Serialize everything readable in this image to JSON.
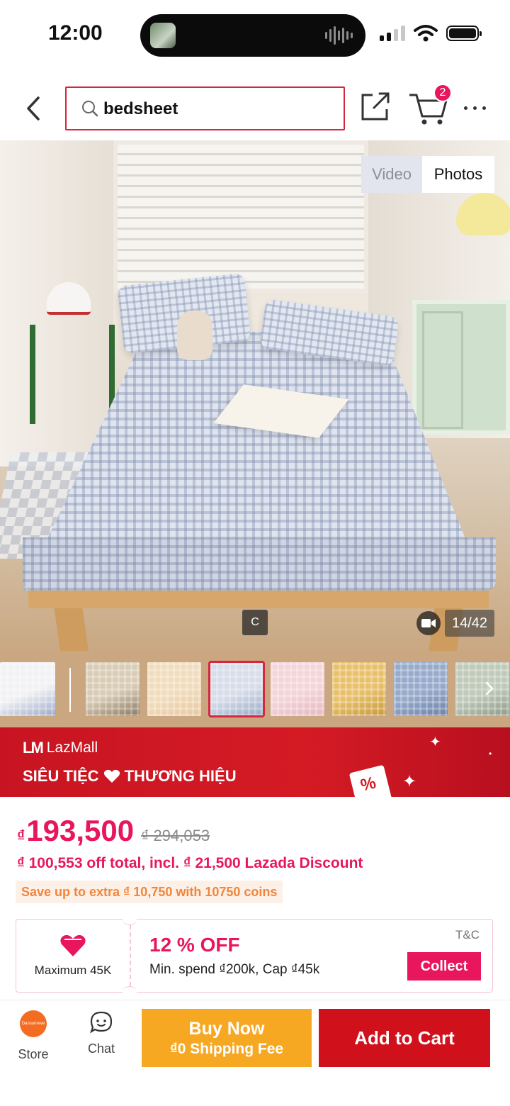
{
  "status_bar": {
    "time": "12:00"
  },
  "header": {
    "search_query": "bedsheet",
    "cart_count": "2"
  },
  "gallery": {
    "toggle_video": "Video",
    "toggle_photos": "Photos",
    "active_toggle": "Photos",
    "c_label": "C",
    "counter": "14/42",
    "thumbnails": [
      {
        "name": "thumb-fitted-sheet-info",
        "colors": [
          "#f2f2f4",
          "#9aa9c8"
        ]
      },
      {
        "name": "thumb-beige-check",
        "colors": [
          "#d9ccb5",
          "#8c7a62"
        ]
      },
      {
        "name": "thumb-cream",
        "colors": [
          "#f1dcbd",
          "#e7c9a0"
        ]
      },
      {
        "name": "thumb-blue-check",
        "colors": [
          "#d7deea",
          "#9aaac6"
        ],
        "selected": true
      },
      {
        "name": "thumb-pink",
        "colors": [
          "#f3d5da",
          "#e6b7bf"
        ]
      },
      {
        "name": "thumb-yellow-check",
        "colors": [
          "#e8c06b",
          "#c89a3a"
        ]
      },
      {
        "name": "thumb-blue-floral",
        "colors": [
          "#97aacb",
          "#6d82a8"
        ]
      },
      {
        "name": "thumb-green-check",
        "colors": [
          "#bfcab9",
          "#8e9c89"
        ]
      }
    ]
  },
  "banner": {
    "brand": "LazMall",
    "title_part1": "SIÊU TIỆC",
    "title_part2": "THƯƠNG HIỆU",
    "brand_color": "#d41b24"
  },
  "price": {
    "currency": "₫",
    "current": "193,500",
    "original": "₫ 294,053",
    "discount_text": "₫ 100,553 off total, incl. ₫ 21,500 Lazada Discount",
    "coins_text": "Save up to extra ₫ 10,750 with 10750 coins",
    "accent_color": "#e8175d"
  },
  "voucher": {
    "max_label": "Maximum 45K",
    "percent_off": "12 % OFF",
    "condition": "Min. spend ₫200k, Cap ₫45k",
    "tc_label": "T&C",
    "collect_label": "Collect"
  },
  "bottom_bar": {
    "store_label": "Store",
    "store_avatar_text": "Dansunreve",
    "chat_label": "Chat",
    "buy_now_title": "Buy Now",
    "buy_now_sub": "₫0 Shipping Fee",
    "add_to_cart": "Add to Cart",
    "buy_color": "#f7a823",
    "cart_color": "#d0111b"
  }
}
